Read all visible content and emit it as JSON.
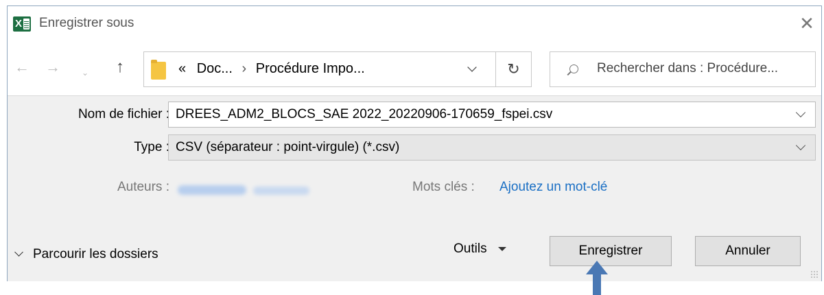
{
  "window": {
    "title": "Enregistrer sous",
    "close_glyph": "✕"
  },
  "nav": {
    "back_glyph": "←",
    "forward_glyph": "→",
    "recent_glyph": "⌄",
    "up_glyph": "↑",
    "refresh_glyph": "↻"
  },
  "address": {
    "overflow_glyph": "«",
    "crumbs": [
      "Doc...",
      "Procédure Impo..."
    ],
    "separator": "›"
  },
  "search": {
    "placeholder": "Rechercher dans : Procédure..."
  },
  "form": {
    "filename_label": "Nom de fichier :",
    "filename_value": "DREES_ADM2_BLOCS_SAE 2022_20220906-170659_fspei.csv",
    "type_label": "Type :",
    "type_value": "CSV (séparateur : point-virgule) (*.csv)",
    "authors_label": "Auteurs :",
    "keywords_label": "Mots clés :",
    "keywords_link": "Ajoutez un mot-clé"
  },
  "footer": {
    "browse_label": "Parcourir les dossiers",
    "tools_label": "Outils",
    "save_label": "Enregistrer",
    "cancel_label": "Annuler"
  },
  "colors": {
    "excel_green": "#1d6f42",
    "link_blue": "#1a6fc4",
    "annotation_arrow": "#4a78b4"
  }
}
